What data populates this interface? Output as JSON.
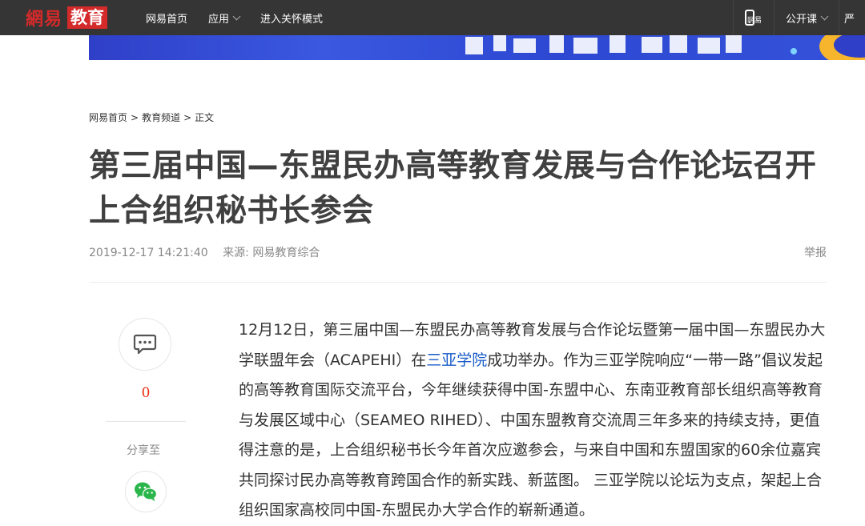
{
  "header": {
    "logo_163": "網易",
    "logo_section": "教育",
    "nav": [
      {
        "label": "网易首页"
      },
      {
        "label": "应用"
      },
      {
        "label": "进入关怀模式"
      }
    ],
    "phone_label": "网易",
    "open_course": "公开课",
    "cut_off": "严"
  },
  "breadcrumb": {
    "home": "网易首页",
    "channel": "教育频道",
    "current": "正文",
    "sep": ">"
  },
  "article": {
    "title": "第三届中国—东盟民办高等教育发展与合作论坛召开 上合组织秘书长参会",
    "datetime": "2019-12-17 14:21:40",
    "source": "来源: 网易教育综合",
    "report": "举报",
    "body_part1": "12月12日，第三届中国—东盟民办高等教育发展与合作论坛暨第一届中国—东盟民办大学联盟年会（ACAPEHI）在",
    "body_link": "三亚学院",
    "body_part2": "成功举办。作为三亚学院响应“一带一路”倡议发起的高等教育国际交流平台，今年继续获得中国-东盟中心、东南亚教育部长组织高等教育与发展区域中心（SEAMEO RIHED）、中国东盟教育交流周三年多来的持续支持，更值得注意的是，上合组织秘书长今年首次应邀参会，与来自中国和东盟国家的60余位嘉宾共同探讨民办高等教育跨国合作的新实践、新蓝图。 三亚学院以论坛为支点，架起上合组织国家高校同中国-东盟民办大学合作的崭新通道。"
  },
  "sidebar": {
    "comment_count": "0",
    "share_label": "分享至"
  },
  "colors": {
    "topbar": "#353535",
    "brand_red": "#d42a2a",
    "link_blue": "#1a5cc8",
    "comment_red": "#e8290f",
    "wechat_green": "#2ab64a"
  }
}
